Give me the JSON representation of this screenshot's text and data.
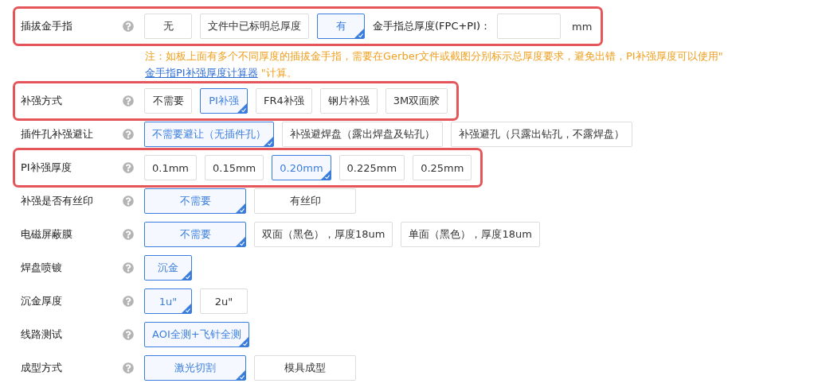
{
  "rows": [
    {
      "label": "插拔金手指",
      "highlighted": true,
      "kind": "compact",
      "options": [
        {
          "label": "无",
          "selected": false
        },
        {
          "label": "文件中已标明总厚度",
          "selected": false
        },
        {
          "label": "有",
          "selected": true
        }
      ],
      "thickness": {
        "label": "金手指总厚度(FPC+PI)：",
        "unit": "mm"
      },
      "note": {
        "before": "注：如板上面有多个不同厚度的插拔金手指，需要在Gerber文件或截图分别标示总厚度要求，避免出错，PI补强厚度可以使用\" ",
        "link": "金手指PI补强厚度计算器",
        "after": " \"计算。"
      }
    },
    {
      "label": "补强方式",
      "highlighted": true,
      "kind": "compact",
      "options": [
        {
          "label": "不需要",
          "selected": false
        },
        {
          "label": "PI补强",
          "selected": true
        },
        {
          "label": "FR4补强",
          "selected": false
        },
        {
          "label": "钢片补强",
          "selected": false
        },
        {
          "label": "3M双面胶",
          "selected": false
        }
      ]
    },
    {
      "label": "插件孔补强避让",
      "highlighted": false,
      "kind": "compact",
      "options": [
        {
          "label": "不需要避让（无插件孔）",
          "selected": true
        },
        {
          "label": "补强避焊盘（露出焊盘及钻孔）",
          "selected": false
        },
        {
          "label": "补强避孔（只露出钻孔，不露焊盘）",
          "selected": false
        }
      ]
    },
    {
      "label": "PI补强厚度",
      "highlighted": true,
      "kind": "compact",
      "options": [
        {
          "label": "0.1mm",
          "selected": false
        },
        {
          "label": "0.15mm",
          "selected": false
        },
        {
          "label": "0.20mm",
          "selected": true
        },
        {
          "label": "0.225mm",
          "selected": false
        },
        {
          "label": "0.25mm",
          "selected": false
        }
      ]
    },
    {
      "label": "补强是否有丝印",
      "highlighted": false,
      "kind": "wide",
      "options": [
        {
          "label": "不需要",
          "selected": true
        },
        {
          "label": "有丝印",
          "selected": false
        }
      ]
    },
    {
      "label": "电磁屏蔽膜",
      "highlighted": false,
      "kind": "wide",
      "options": [
        {
          "label": "不需要",
          "selected": true
        },
        {
          "label": "双面（黑色），厚度18um",
          "selected": false
        },
        {
          "label": "单面（黑色），厚度18um",
          "selected": false
        }
      ]
    },
    {
      "label": "焊盘喷镀",
      "highlighted": false,
      "kind": "compact",
      "options": [
        {
          "label": "沉金",
          "selected": true
        }
      ]
    },
    {
      "label": "沉金厚度",
      "highlighted": false,
      "kind": "compact",
      "options": [
        {
          "label": "1u\"",
          "selected": true
        },
        {
          "label": "2u\"",
          "selected": false
        }
      ]
    },
    {
      "label": "线路测试",
      "highlighted": false,
      "kind": "wide",
      "options": [
        {
          "label": "AOI全测+飞针全测",
          "selected": true
        }
      ]
    },
    {
      "label": "成型方式",
      "highlighted": false,
      "kind": "wide",
      "options": [
        {
          "label": "激光切割",
          "selected": true
        },
        {
          "label": "模具成型",
          "selected": false
        }
      ]
    }
  ]
}
